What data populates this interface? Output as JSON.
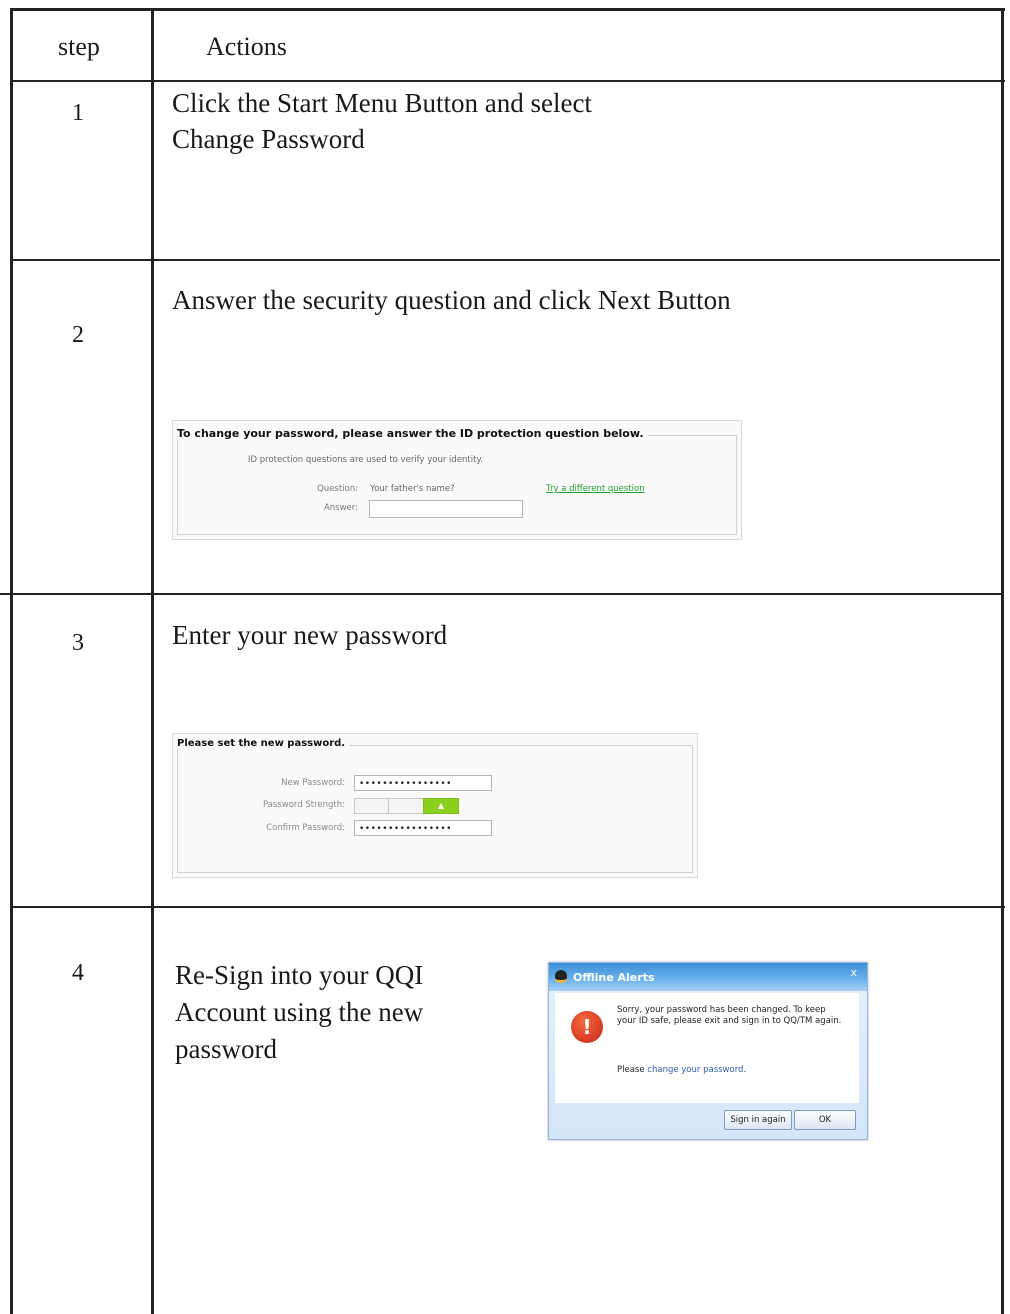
{
  "table": {
    "header": {
      "step": "step",
      "actions": "Actions"
    },
    "rows": [
      {
        "step": "1",
        "text_lines": [
          "Click the Start Menu Button and select",
          "Change Password"
        ]
      },
      {
        "step": "2",
        "text": "Answer the security question and click Next Button"
      },
      {
        "step": "3",
        "text": "Enter your new password"
      },
      {
        "step": "4",
        "text_lines": [
          "Re-Sign into your QQI",
          "Account using the new",
          "password"
        ]
      }
    ]
  },
  "security_panel": {
    "title": "To change your password, please answer the ID protection question below.",
    "subtitle": "ID protection questions are used to verify your identity.",
    "question_label": "Question:",
    "question_value": "Your father's name?",
    "try_link": "Try a different question",
    "answer_label": "Answer:",
    "answer_value": ""
  },
  "new_password_panel": {
    "title": "Please set the new password.",
    "new_password_label": "New Password:",
    "new_password_value": "••••••••••••••••",
    "strength_label": "Password Strength:",
    "strength_level": "3 of 3",
    "strength_icon": "▲",
    "confirm_label": "Confirm Password:",
    "confirm_value": "••••••••••••••••"
  },
  "offline_alert": {
    "title": "Offline Alerts",
    "close": "x",
    "alert_icon": "!",
    "message": "Sorry, your password has been changed. To keep your ID safe, please exit and sign in to QQ/TM again.",
    "please_prefix": "Please ",
    "please_link": "change your password",
    "please_suffix": ".",
    "sign_in_button": "Sign in again",
    "ok_button": "OK",
    "colors": {
      "titlebar": "#3b8fd6",
      "alert": "#c9231b",
      "link": "#2a5fb0"
    }
  }
}
